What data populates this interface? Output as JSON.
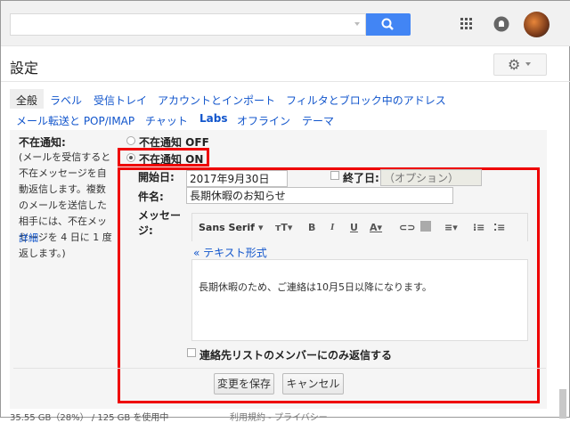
{
  "header": {
    "search_placeholder": "",
    "search_icon": "search-icon",
    "apps_icon": "apps-grid-icon",
    "notifications_icon": "bell-icon",
    "avatar": "user-avatar"
  },
  "page": {
    "title": "設定",
    "settings_icon": "gear-icon"
  },
  "tabs": {
    "row1": [
      "全般",
      "ラベル",
      "受信トレイ",
      "アカウントとインポート",
      "フィルタとブロック中のアドレス"
    ],
    "row2": [
      "メール転送と POP/IMAP",
      "チャット",
      "Labs",
      "オフライン",
      "テーマ"
    ],
    "active": "全般"
  },
  "vacation": {
    "label": "不在通知:",
    "description": "(メールを受信すると不在メッセージを自動返信します。複数のメールを送信した相手には、不在メッセージを 4 日に 1 度返します。)",
    "details_link": "詳細",
    "off_label": "不在通知 OFF",
    "on_label": "不在通知 ON",
    "selected": "on",
    "start_label": "開始日:",
    "start_value": "2017年9月30日",
    "end_label": "終了日:",
    "end_placeholder": "（オプション）",
    "end_checked": false,
    "subject_label": "件名:",
    "subject_value": "長期休暇のお知らせ",
    "message_label": "メッセージ:",
    "font_name": "Sans Serif",
    "plain_text_link": "« テキスト形式",
    "message_body": "長期休暇のため、ご連絡は10月5日以降になります。",
    "contacts_only_label": "連絡先リストのメンバーにのみ返信する",
    "contacts_only_checked": false,
    "save_label": "変更を保存",
    "cancel_label": "キャンセル"
  },
  "footer": {
    "storage": "35.55 GB（28%） / 125 GB を使用中",
    "links": "利用規約 - プライバシー"
  },
  "colors": {
    "accent": "#4285f4",
    "link": "#1155cc",
    "highlight": "#ee0000"
  }
}
